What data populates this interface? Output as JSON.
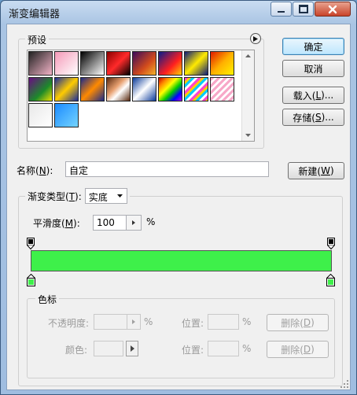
{
  "window": {
    "title": "渐变编辑器"
  },
  "presets": {
    "label": "预设",
    "swatches": [
      {
        "name": "swatch-1",
        "bg": "linear-gradient(135deg,#222 0%,#f3b3c7 100%)"
      },
      {
        "name": "swatch-2",
        "bg": "linear-gradient(135deg,#f59ab8 0%,#fff 100%)"
      },
      {
        "name": "swatch-3",
        "bg": "linear-gradient(135deg,#000 0%,#fff 100%)"
      },
      {
        "name": "swatch-4",
        "bg": "linear-gradient(135deg,#8b0000 0%,#ff2a2a 50%,#000 100%)"
      },
      {
        "name": "swatch-5",
        "bg": "linear-gradient(135deg,#3a0a5c 0%,#d24b1c 60%,#f3b32b 100%)"
      },
      {
        "name": "swatch-6",
        "bg": "linear-gradient(135deg,#0a1b8a 0%,#ff1f1f 60%,#ffd200 100%)"
      },
      {
        "name": "swatch-7",
        "bg": "linear-gradient(135deg,#0b1a7a 0%,#ffea00 50%,#0b1a7a 100%)"
      },
      {
        "name": "swatch-8",
        "bg": "linear-gradient(135deg,#e01a00 0%,#ffb000 50%,#fff200 100%)"
      },
      {
        "name": "swatch-9",
        "bg": "linear-gradient(135deg,#6a0d83 0%,#1c8a2a 60%,#f0e000 100%)"
      },
      {
        "name": "swatch-10",
        "bg": "linear-gradient(135deg,#1a2c9a 0%,#ffcc00 50%,#1a2c9a 100%)"
      },
      {
        "name": "swatch-11",
        "bg": "linear-gradient(135deg,#1b2a8a 0%,#ff8a00 50%,#1b2a8a 100%)"
      },
      {
        "name": "swatch-12",
        "bg": "linear-gradient(135deg,#5a2a10 0%,#e8a070 40%,#fff 60%,#5a2a10 100%)"
      },
      {
        "name": "swatch-13",
        "bg": "linear-gradient(135deg,#0a3a9a 0%,#fff 50%,#0a3a9a 100%)"
      },
      {
        "name": "swatch-14",
        "bg": "linear-gradient(135deg,#c00 0%,#f80 20%,#ff0 40%,#0c0 60%,#00f 80%,#a0f 100%)"
      },
      {
        "name": "swatch-15",
        "bg": "repeating-linear-gradient(135deg,#f4c 0 3px,#fc0 3px 6px,#0cf 6px 9px,#fff 9px 12px)"
      },
      {
        "name": "swatch-16",
        "bg": "repeating-linear-gradient(135deg,#f7a8c8 0 3px,#fff 3px 6px)"
      },
      {
        "name": "swatch-17",
        "bg": "linear-gradient(135deg,#e8e8e8 0%,#fff 100%)"
      },
      {
        "name": "swatch-18",
        "bg": "linear-gradient(135deg,#1c8bff 0%,#74d4ff 100%)"
      }
    ]
  },
  "buttons": {
    "ok": "确定",
    "cancel": "取消",
    "load_text": "载入(",
    "load_key": "L",
    "load_suffix": ")...",
    "save_text": "存储(",
    "save_key": "S",
    "save_suffix": ")...",
    "new_text": "新建(",
    "new_key": "W",
    "new_suffix": ")"
  },
  "name_field": {
    "label_text": "名称(",
    "label_key": "N",
    "label_suffix": "):",
    "value": "自定"
  },
  "gradient_type": {
    "label_text": "渐变类型(",
    "label_key": "T",
    "label_suffix": "):",
    "value": "实底"
  },
  "smoothness": {
    "label_text": "平滑度(",
    "label_key": "M",
    "label_suffix": "):",
    "value": "100",
    "unit": "%"
  },
  "gradient_bar": {
    "color": "#3ef04a"
  },
  "color_stops_group": {
    "label": "色标",
    "opacity_label": "不透明度:",
    "opacity_unit": "%",
    "location_label_1": "位置:",
    "location_unit_1": "%",
    "delete_text_1": "删除(",
    "delete_key_1": "D",
    "delete_suffix_1": ")",
    "color_label": "颜色:",
    "location_label_2": "位置:",
    "location_unit_2": "%",
    "delete_text_2": "删除(",
    "delete_key_2": "D",
    "delete_suffix_2": ")"
  }
}
